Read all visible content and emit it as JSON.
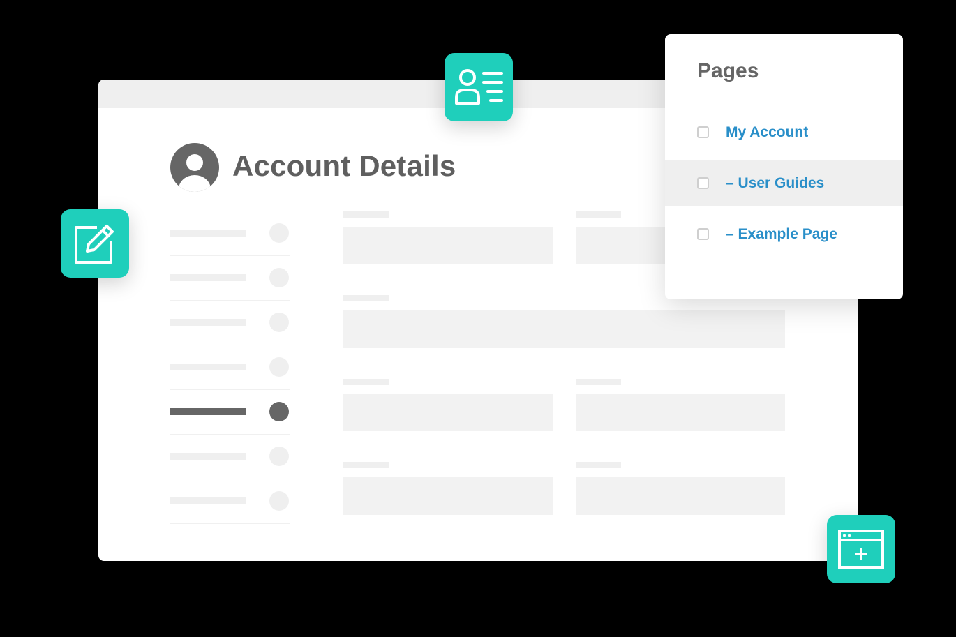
{
  "main": {
    "title": "Account Details"
  },
  "pages_panel": {
    "title": "Pages",
    "items": [
      {
        "label": "My Account",
        "checked": false,
        "highlighted": false
      },
      {
        "label": "– User Guides",
        "checked": false,
        "highlighted": true
      },
      {
        "label": "– Example Page",
        "checked": false,
        "highlighted": false
      }
    ]
  },
  "floating_icons": [
    {
      "name": "user-profile-icon"
    },
    {
      "name": "edit-icon"
    },
    {
      "name": "add-window-icon"
    }
  ],
  "colors": {
    "accent": "#1fcfbb",
    "link": "#2a8fc9",
    "title_text": "#5f5f5f",
    "skeleton": "#efefef",
    "active": "#666666"
  }
}
